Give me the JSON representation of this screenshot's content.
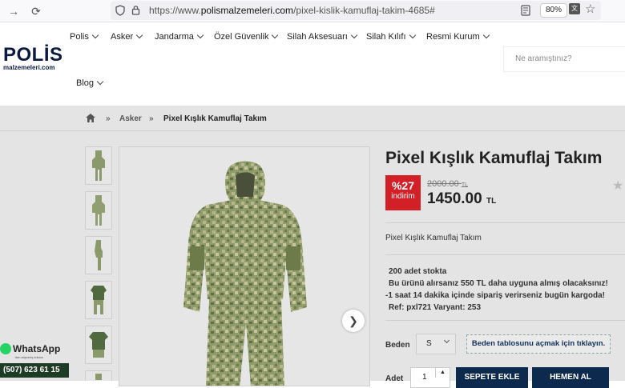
{
  "browser": {
    "url_prefix": "https://www.",
    "url_domain": "polismalzemeleri.com",
    "url_path": "/pixel-kislik-kamuflaj-takim-4685#",
    "zoom": "80%"
  },
  "logo": {
    "main": "POLİS",
    "sub": "malzemeleri.com"
  },
  "menu": [
    {
      "label": "Polis"
    },
    {
      "label": "Asker"
    },
    {
      "label": "Jandarma"
    },
    {
      "label": "Özel Güvenlik"
    },
    {
      "label": "Silah Aksesuarı"
    },
    {
      "label": "Silah Kılıfı"
    },
    {
      "label": "Resmi Kurum"
    },
    {
      "label": "Blog"
    }
  ],
  "search": {
    "placeholder": "Ne aramıştınız?"
  },
  "breadcrumb": {
    "sep": "»",
    "level1": "Asker",
    "current": "Pixel Kışlık Kamuflaj Takım"
  },
  "product": {
    "title": "Pixel Kışlık Kamuflaj Takım",
    "discount_percent": "%27",
    "discount_label": "indirim",
    "old_price": "2000.00",
    "old_currency": "TL",
    "price": "1450.00",
    "currency": "TL",
    "description": "Pixel Kışlık Kamuflaj Takım",
    "stock": "200 adet stokta",
    "offer": "Bu ürünü alırsanız 550 TL daha uyguna almış olacaksınız!",
    "shipping": "-1 saat 14 dakika içinde sipariş verirseniz bugün kargoda!",
    "ref": "Ref: pxl721 Varyant: 253",
    "size_label": "Beden",
    "size_value": "S",
    "size_chart": "Beden tablosunu açmak için tıklayın.",
    "qty_label": "Adet",
    "qty_value": "1",
    "add_to_cart": "SEPETE EKLE",
    "buy_now": "HEMEN AL"
  },
  "whatsapp": {
    "label": "WhatsApp",
    "tagline": "'dan alışveriş imkanı",
    "phone": "(507) 623 61 15"
  },
  "colors": {
    "accent": "#0d2a4e",
    "discount": "#d31f26",
    "whatsapp": "#25d366"
  }
}
